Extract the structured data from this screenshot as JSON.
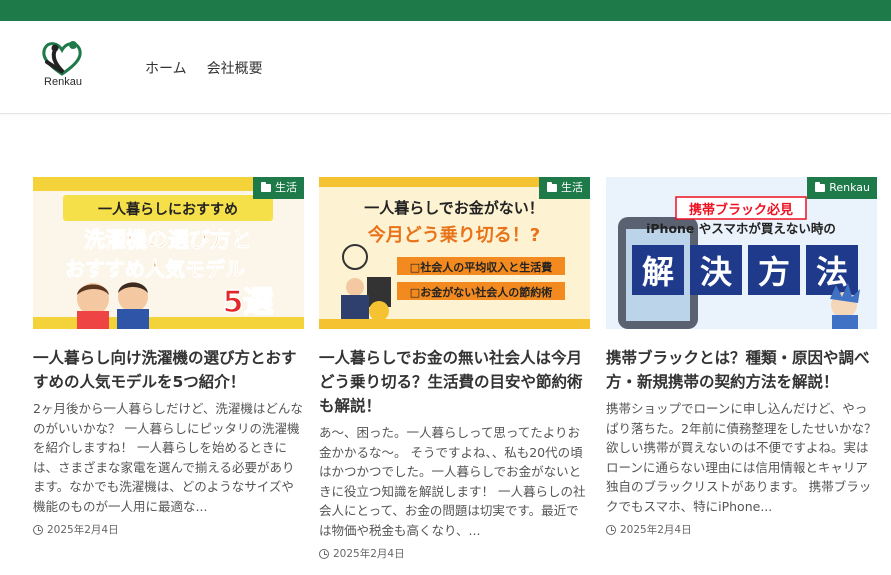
{
  "header": {
    "logo_text": "Renkau",
    "nav": [
      {
        "label": "ホーム"
      },
      {
        "label": "会社概要"
      }
    ]
  },
  "colors": {
    "brand": "#1f7a4a"
  },
  "cards": [
    {
      "category": "生活",
      "thumb_lines": [
        "一人暮らしにおすすめ",
        "洗濯機の選び方と",
        "おすすめ人気モデル",
        "5選"
      ],
      "title": "一人暮らし向け洗濯機の選び方とおすすめの人気モデルを5つ紹介！",
      "excerpt": "2ヶ月後から一人暮らしだけど、洗濯機はどんなのがいいかな？ 一人暮らしにピッタリの洗濯機を紹介しますね！ 一人暮らしを始めるときには、さまざまな家電を選んで揃える必要があります。なかでも洗濯機は、どのようなサイズや機能のものが一人用に最適な...",
      "date": "2025年2月4日"
    },
    {
      "category": "生活",
      "thumb_lines": [
        "一人暮らしでお金がない！",
        "今月どう乗り切る！?",
        "□社会人の平均収入と生活費",
        "□お金がない社会人の節約術"
      ],
      "title": "一人暮らしでお金の無い社会人は今月どう乗り切る？生活費の目安や節約術も解説！",
      "excerpt": "あ〜、困った。一人暮らしって思ってたよりお金かかるな〜。 そうですよね、、私も20代の頃はかつかつでした。一人暮らしでお金がないときに役立つ知識を解説します！ 一人暮らしの社会人にとって、お金の問題は切実です。最近では物価や税金も高くなり、...",
      "date": "2025年2月4日"
    },
    {
      "category": "Renkau",
      "thumb_lines": [
        "携帯ブラック必見",
        "iPhone やスマホが買えない時の",
        "解",
        "決",
        "方",
        "法"
      ],
      "title": "携帯ブラックとは？種類・原因や調べ方・新規携帯の契約方法を解説！",
      "excerpt": "携帯ショップでローンに申し込んだけど、やっぱり落ちた。2年前に債務整理をしたせいかな？ 欲しい携帯が買えないのは不便ですよね。実はローンに通らない理由には信用情報とキャリア独自のブラックリストがあります。 携帯ブラックでもスマホ、特にiPhone...",
      "date": "2025年2月4日"
    }
  ]
}
